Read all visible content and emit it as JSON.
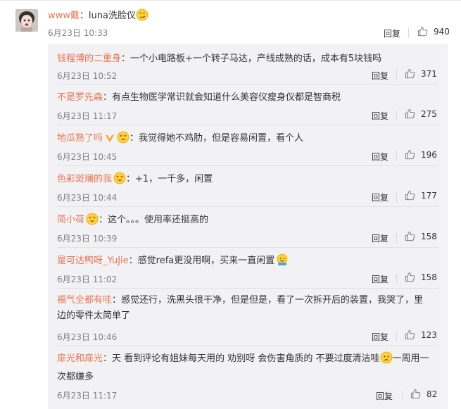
{
  "main": {
    "username": "www戴",
    "text": "：luna洗脸仪",
    "emoji": "smirk-emoji",
    "time": "6月23日 10:33",
    "reply_label": "回复",
    "likes": "940"
  },
  "replies": [
    {
      "user": "钱程博的二重身",
      "text": "：一个小电路板+一个转子马达，产线成熟的话，成本有5块钱吗",
      "time": "6月23日 10:52",
      "reply_label": "回复",
      "likes": "371"
    },
    {
      "user": "不是罗先森",
      "text": "：有点生物医学常识就会知道什么美容仪瘦身仪都是智商税",
      "time": "6月23日 11:17",
      "reply_label": "回复",
      "likes": "275"
    },
    {
      "user": "地瓜熟了吗",
      "text": "：我觉得她不鸡肋，但是容易闲置，看个人",
      "time": "6月23日 10:45",
      "reply_label": "回复",
      "likes": "196"
    },
    {
      "user": "色彩斑斓的我",
      "text": "：+1，一千多，闲置",
      "time": "6月23日 10:44",
      "reply_label": "回复",
      "likes": "177"
    },
    {
      "user": "简小荷",
      "text": "：这个。。。使用率还挺高的",
      "time": "6月23日 10:39",
      "reply_label": "回复",
      "likes": "158"
    },
    {
      "user": "是可达鸭呀_YuJie",
      "text": "：感觉refa更没用啊，买来一直闲置",
      "time": "6月23日 11:02",
      "reply_label": "回复",
      "likes": "158"
    },
    {
      "user": "福气全都有哇",
      "text": "：感觉还行，洗黑头很干净，但是但是，看了一次拆开后的装置，我哭了，里边的零件太简单了",
      "time": "6月23日 10:46",
      "reply_label": "回复",
      "likes": "123"
    },
    {
      "user": "扉光和扉光",
      "text": "：天 看到评论有姐妹每天用的 劝别呀 会伤害角质的 不要过度清洁哇",
      "text2": "一周用一次都嫌多",
      "time": "6月23日 11:17",
      "reply_label": "回复",
      "likes": "82"
    }
  ]
}
